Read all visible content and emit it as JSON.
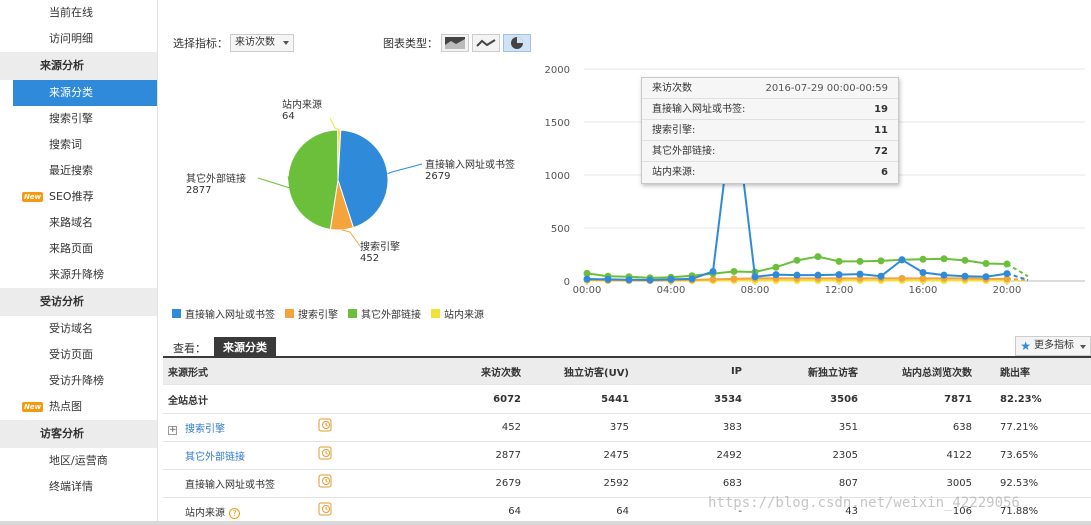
{
  "sidebar": {
    "items": [
      {
        "label": "当前在线",
        "type": "item"
      },
      {
        "label": "访问明细",
        "type": "item"
      },
      {
        "label": "来源分析",
        "type": "head"
      },
      {
        "label": "来源分类",
        "type": "active"
      },
      {
        "label": "搜索引擎",
        "type": "item"
      },
      {
        "label": "搜索词",
        "type": "item"
      },
      {
        "label": "最近搜索",
        "type": "item"
      },
      {
        "label": "SEO推荐",
        "type": "item",
        "badge": "New"
      },
      {
        "label": "来路域名",
        "type": "item"
      },
      {
        "label": "来路页面",
        "type": "item"
      },
      {
        "label": "来源升降榜",
        "type": "item"
      },
      {
        "label": "受访分析",
        "type": "head"
      },
      {
        "label": "受访域名",
        "type": "item"
      },
      {
        "label": "受访页面",
        "type": "item"
      },
      {
        "label": "受访升降榜",
        "type": "item"
      },
      {
        "label": "热点图",
        "type": "item",
        "badge": "New"
      },
      {
        "label": "访客分析",
        "type": "head"
      },
      {
        "label": "地区/运营商",
        "type": "item"
      },
      {
        "label": "终端详情",
        "type": "item"
      }
    ]
  },
  "toolbar": {
    "metric_label": "选择指标：",
    "metric_value": "来访次数",
    "chart_type_label": "图表类型："
  },
  "pie": {
    "labels": [
      {
        "name": "站内来源",
        "value": "64"
      },
      {
        "name": "直接输入网址或书签",
        "value": "2679"
      },
      {
        "name": "其它外部链接",
        "value": "2877"
      },
      {
        "name": "搜索引擎",
        "value": "452"
      }
    ]
  },
  "legend": [
    {
      "label": "直接输入网址或书签",
      "color": "#2f8ad9"
    },
    {
      "label": "搜索引擎",
      "color": "#f4a43c"
    },
    {
      "label": "其它外部链接",
      "color": "#6cbf3b"
    },
    {
      "label": "站内来源",
      "color": "#f1e23a"
    }
  ],
  "tooltip": {
    "title": "来访次数",
    "time": "2016-07-29 00:00-00:59",
    "rows": [
      {
        "label": "直接输入网址或书签:",
        "value": "19"
      },
      {
        "label": "搜索引擎:",
        "value": "11"
      },
      {
        "label": "其它外部链接:",
        "value": "72"
      },
      {
        "label": "站内来源:",
        "value": "6"
      }
    ]
  },
  "chart_data": [
    {
      "type": "pie",
      "categories": [
        "直接输入网址或书签",
        "搜索引擎",
        "其它外部链接",
        "站内来源"
      ],
      "values": [
        2679,
        452,
        2877,
        64
      ],
      "colors": [
        "#2f8ad9",
        "#f4a43c",
        "#6cbf3b",
        "#f1e23a"
      ]
    },
    {
      "type": "line",
      "x": [
        0,
        1,
        2,
        3,
        4,
        5,
        6,
        7,
        8,
        9,
        10,
        11,
        12,
        13,
        14,
        15,
        16,
        17,
        18,
        19,
        20,
        21
      ],
      "xticks": [
        "00:00",
        "04:00",
        "08:00",
        "12:00",
        "16:00",
        "20:00"
      ],
      "ylim": [
        0,
        2000
      ],
      "yticks": [
        "0",
        "500",
        "1000",
        "1500",
        "2000"
      ],
      "grid": true,
      "series": [
        {
          "name": "直接输入网址或书签",
          "color": "#2f8ad9",
          "values": [
            19,
            15,
            12,
            10,
            15,
            20,
            90,
            1700,
            40,
            60,
            55,
            55,
            60,
            65,
            45,
            200,
            80,
            55,
            45,
            40,
            70,
            10
          ]
        },
        {
          "name": "搜索引擎",
          "color": "#f4a43c",
          "values": [
            11,
            8,
            6,
            5,
            8,
            10,
            15,
            20,
            25,
            25,
            25,
            25,
            25,
            25,
            25,
            25,
            25,
            25,
            25,
            20,
            20,
            10
          ]
        },
        {
          "name": "其它外部链接",
          "color": "#6cbf3b",
          "values": [
            72,
            45,
            40,
            30,
            35,
            50,
            70,
            90,
            85,
            130,
            195,
            230,
            185,
            185,
            190,
            200,
            205,
            210,
            195,
            165,
            160,
            45
          ]
        },
        {
          "name": "站内来源",
          "color": "#f1e23a",
          "values": [
            6,
            4,
            4,
            3,
            3,
            4,
            5,
            5,
            5,
            5,
            5,
            5,
            5,
            5,
            5,
            5,
            5,
            5,
            5,
            5,
            5,
            3
          ]
        }
      ]
    }
  ],
  "view": {
    "label": "查看：",
    "tab": "来源分类",
    "more": "更多指标"
  },
  "table": {
    "headers": [
      "来源形式",
      "来访次数",
      "独立访客(UV)",
      "IP",
      "新独立访客",
      "站内总浏览次数",
      "跳出率"
    ],
    "total": [
      "全站总计",
      "6072",
      "5441",
      "3534",
      "3506",
      "7871",
      "82.23%"
    ],
    "rows": [
      {
        "cells": [
          "搜索引擎",
          "452",
          "375",
          "383",
          "351",
          "638",
          "77.21%"
        ],
        "expand": true,
        "link": true
      },
      {
        "cells": [
          "其它外部链接",
          "2877",
          "2475",
          "2492",
          "2305",
          "4122",
          "73.65%"
        ],
        "link": true
      },
      {
        "cells": [
          "直接输入网址或书签",
          "2679",
          "2592",
          "683",
          "807",
          "3005",
          "92.53%"
        ]
      },
      {
        "cells": [
          "站内来源",
          "64",
          "64",
          "-",
          "43",
          "106",
          "71.88%"
        ],
        "help": true
      }
    ]
  },
  "watermark": "https://blog.csdn.net/weixin_42229056"
}
